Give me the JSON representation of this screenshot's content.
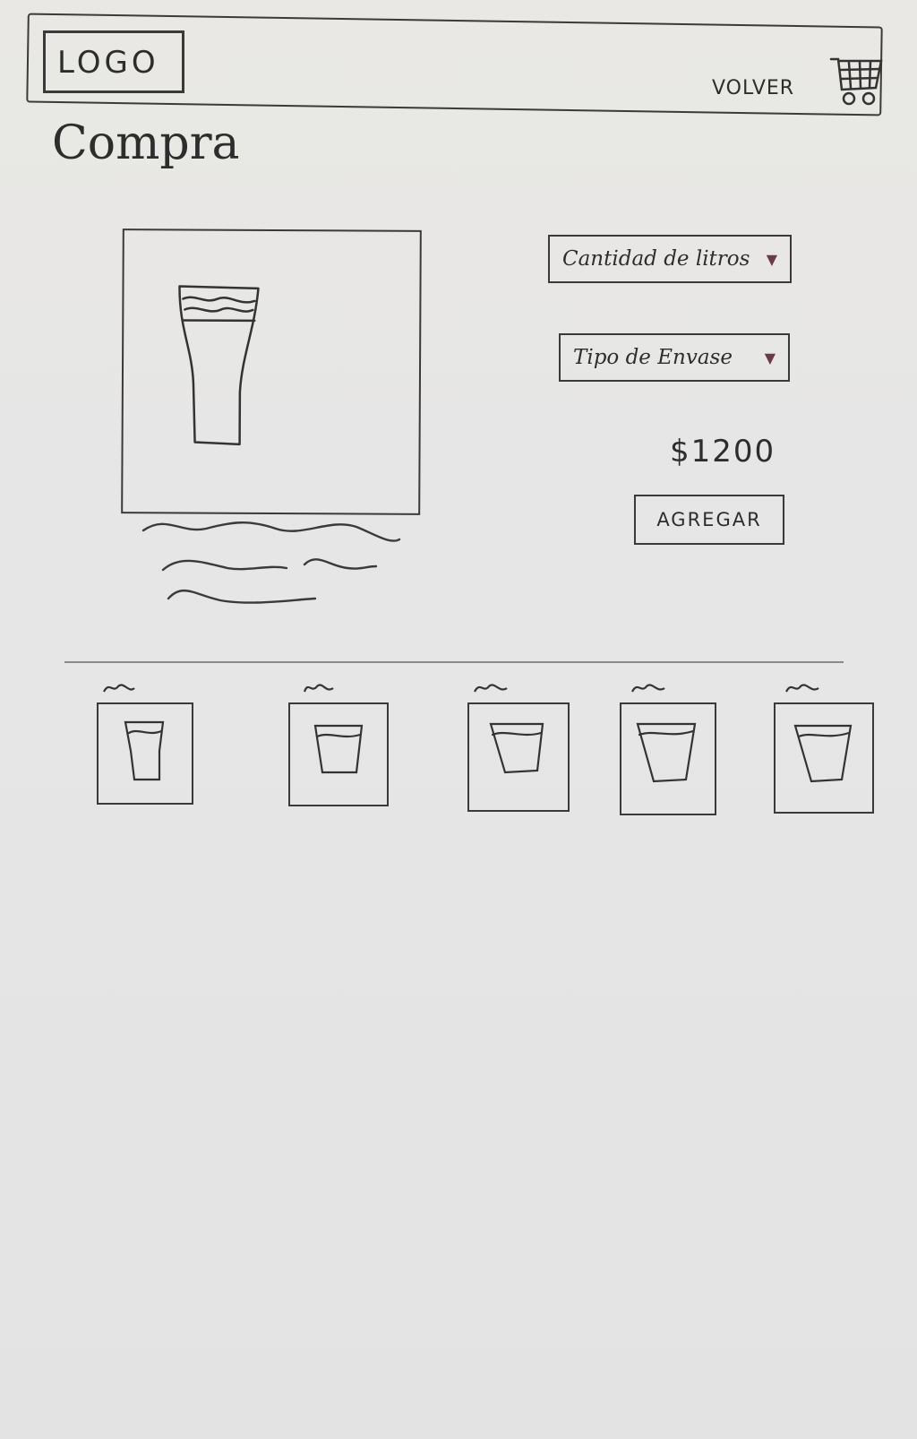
{
  "header": {
    "logo": "LOGO",
    "back_label": "VOLVER",
    "cart_icon": "cart-icon"
  },
  "page": {
    "title": "Compra"
  },
  "product": {
    "image_icon": "beer-glass-icon",
    "description_icon": "scribbled-text-lines"
  },
  "options": {
    "liters_label": "Cantidad de litros",
    "container_label": "Tipo de Envase"
  },
  "price": "$1200",
  "add_button": "AGREGAR",
  "related": {
    "item_icon": "beer-glass-icon"
  }
}
